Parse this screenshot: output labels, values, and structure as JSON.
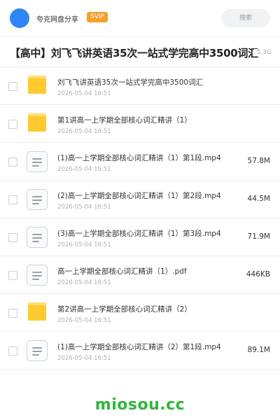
{
  "header": {
    "brand": "夸克网盘分享",
    "badge": "SVIP",
    "search_placeholder": "搜索",
    "accent": "#2f86f6",
    "badge_color": "#f6a02d"
  },
  "folder": {
    "title": "【高中】刘飞飞讲英语35次一站式学完高中3500词汇",
    "total_size": "5.3G"
  },
  "files": [
    {
      "type": "folder",
      "icon": "folder-icon",
      "name": "刘飞飞讲英语35次一站式学完高中3500词汇",
      "date": "2026-05-04 16:51",
      "size": ""
    },
    {
      "type": "folder",
      "icon": "folder-icon",
      "name": "第1讲高一上学期全部核心词汇精讲（1）",
      "date": "2026-05-04 16:51",
      "size": ""
    },
    {
      "type": "file",
      "icon": "document-icon",
      "name": "(1)高一上学期全部核心词汇精讲（1）第1段.mp4",
      "date": "2026-05-04 16:51",
      "size": "57.8M"
    },
    {
      "type": "file",
      "icon": "document-icon",
      "name": "(2)高一上学期全部核心词汇精讲（1）第2段.mp4",
      "date": "2026-05-04 16:51",
      "size": "44.5M"
    },
    {
      "type": "file",
      "icon": "document-icon",
      "name": "(3)高一上学期全部核心词汇精讲（1）第3段.mp4",
      "date": "2026-05-04 16:51",
      "size": "71.9M"
    },
    {
      "type": "file",
      "icon": "document-icon",
      "name": "高一上学期全部核心词汇精讲（1）.pdf",
      "date": "2026-05-04 16:51",
      "size": "446KB"
    },
    {
      "type": "folder",
      "icon": "folder-icon",
      "name": "第2讲高一上学期全部核心词汇精讲（2）",
      "date": "2026-05-04 16:51",
      "size": ""
    },
    {
      "type": "file",
      "icon": "document-icon",
      "name": "(1)高一上学期全部核心词汇精讲（2）第1段.mp4",
      "date": "2026-05-04 16:51",
      "size": "89.1M"
    }
  ],
  "watermark": "miosou.cc"
}
